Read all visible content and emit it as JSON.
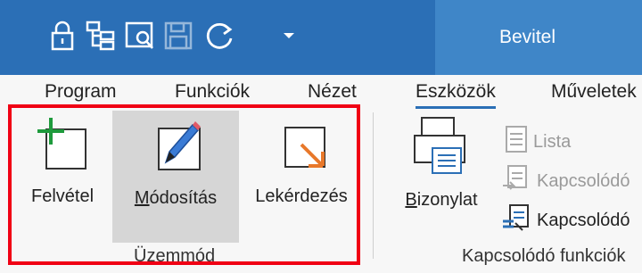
{
  "quick_access": [
    {
      "name": "lock-icon"
    },
    {
      "name": "tree-view-icon"
    },
    {
      "name": "preview-icon"
    },
    {
      "name": "save-icon"
    },
    {
      "name": "refresh-icon"
    },
    {
      "name": "customize-dropdown-icon"
    }
  ],
  "context_tab": "Bevitel",
  "tabs": [
    {
      "label": "Program"
    },
    {
      "label": "Funkciók"
    },
    {
      "label": "Nézet"
    },
    {
      "label": "Eszközök",
      "active": true
    },
    {
      "label": "Műveletek"
    }
  ],
  "groups": {
    "mode": {
      "label": "Üzemmód",
      "buttons": [
        {
          "label": "Felvétel",
          "icon": "add-record-icon"
        },
        {
          "label": "Módosítás",
          "icon": "edit-pencil-icon",
          "selected": true
        },
        {
          "label": "Lekérdezés",
          "icon": "query-arrow-icon"
        }
      ]
    },
    "related": {
      "label": "Kapcsolódó funkciók",
      "big_button": {
        "label": "Bizonylat",
        "icon": "printer-document-icon"
      },
      "small_buttons": [
        {
          "label": "Lista",
          "icon": "list-document-icon",
          "disabled": true
        },
        {
          "label": "Kapcsolódó",
          "icon": "linked-document-icon",
          "disabled": true
        },
        {
          "label": "Kapcsolódó",
          "icon": "attachment-document-icon",
          "disabled": false
        }
      ]
    }
  },
  "colors": {
    "title_bar": "#2b6fb6",
    "highlight_frame": "#f00014",
    "selected_button": "#d6d6d6"
  }
}
